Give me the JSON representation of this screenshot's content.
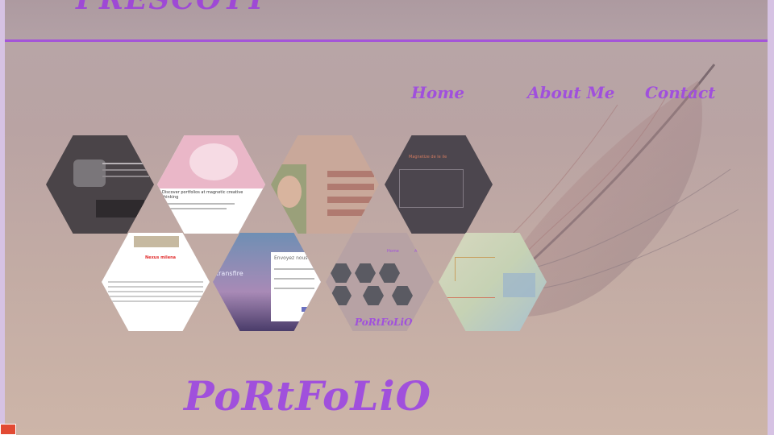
{
  "header": {
    "title": "PRESCOTT"
  },
  "nav": {
    "home": "Home",
    "about": "About Me",
    "contact": "Contact"
  },
  "main": {
    "heading": "PoRtFoLiO"
  },
  "thumbs": {
    "t2_label": "Discover portfolios at magnetic creative thinking",
    "t4_label": "Magnetize de le ile",
    "t5_label": "Nexus milena",
    "t6_label": "transfire",
    "t6_form_title": "Envoyez nous",
    "t7_label": "PoRtFoLiO",
    "t7_nav_home": "Home",
    "t7_nav_about": "Ab"
  },
  "colors": {
    "accent": "#a050dc",
    "frame_bg": "#b9a3a3",
    "outer_bg": "#d6c2e3"
  }
}
